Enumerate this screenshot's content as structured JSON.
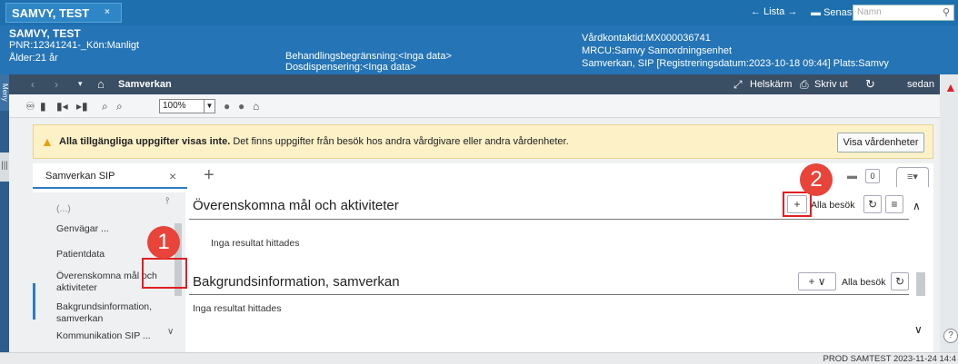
{
  "patient_tab": {
    "title": "SAMVY, TEST",
    "close": "×"
  },
  "top_nav": {
    "lista": "← Lista →",
    "senaste": "Senaste ▾",
    "search_placeholder": "Namn"
  },
  "header": {
    "name": "SAMVY, TEST",
    "pnr": "PNR:12341241-_Kön:Manligt",
    "age": "Ålder:21 år",
    "behandling": "Behandlingsbegränsning:<Inga data>",
    "dos": "Dosdispensering:<Inga data>",
    "kontakt": "Vårdkontaktid:MX000036741",
    "mrcu": "MRCU:Samvy Samordningsenhet",
    "reg": "Samverkan, SIP [Registreringsdatum:2023-10-18 09:44] Plats:Samvy"
  },
  "rail": {
    "label": "Meny"
  },
  "breadcrumb": {
    "current": "Samverkan",
    "fullscreen": "Helskärm",
    "print": "Skriv ut",
    "later": "sedan"
  },
  "toolbar": {
    "zoom": "100%"
  },
  "warning": {
    "bold": "Alla tillgängliga uppgifter visas inte.",
    "text": "Det finns uppgifter från besök hos andra vårdgivare eller andra vårdenheter.",
    "button": "Visa vårdenheter"
  },
  "tabs": {
    "active": "Samverkan SIP",
    "counter": "0"
  },
  "sidebar": {
    "items": [
      {
        "label": "(...)"
      },
      {
        "label": "Genvägar ..."
      },
      {
        "label": "Patientdata"
      },
      {
        "label": "Överenskomna mål och aktiviteter"
      },
      {
        "label": "Bakgrundsinformation, samverkan"
      },
      {
        "label": "Kommunikation SIP ..."
      }
    ]
  },
  "sections": [
    {
      "title": "Överenskomna mål och aktiviteter",
      "empty": "Inga resultat hittades",
      "filter": "Alla besök"
    },
    {
      "title": "Bakgrundsinformation, samverkan",
      "empty": "Inga resultat hittades",
      "filter": "Alla besök"
    }
  ],
  "callouts": {
    "one": "1",
    "two": "2"
  },
  "status": {
    "text": "PROD  SAMTEST  2023-11-24  14:4"
  }
}
